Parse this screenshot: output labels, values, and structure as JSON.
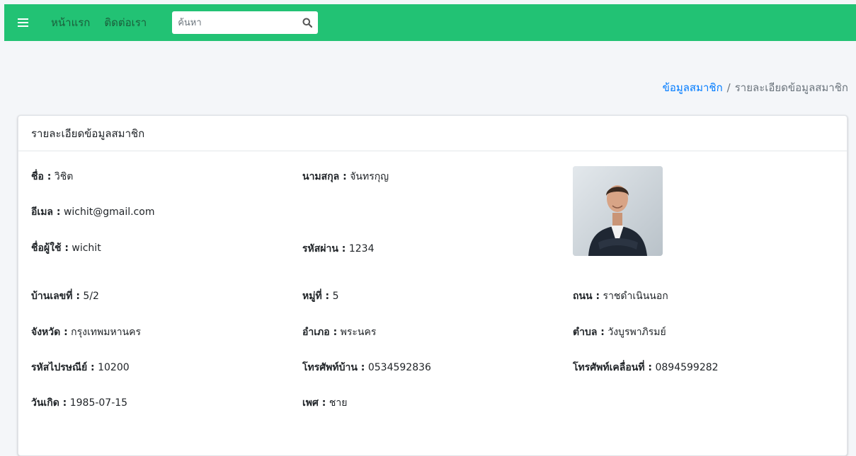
{
  "navbar": {
    "menu_icon": "hamburger-icon",
    "links": [
      "หน้าแรก",
      "ติดต่อเรา"
    ],
    "search": {
      "placeholder": "ค้นหา",
      "value": "",
      "icon": "search-icon"
    },
    "color": "#22c274"
  },
  "breadcrumb": {
    "parent": "ข้อมูลสมาชิก",
    "separator": "/",
    "current": "รายละเอียดข้อมูลสมาชิก"
  },
  "card": {
    "title": "รายละเอียดข้อมูลสมาชิก",
    "photo_alt": "member-photo",
    "fields": {
      "first_name": {
        "label": "ชื่อ :",
        "value": "วิชิต"
      },
      "last_name": {
        "label": "นามสกุล :",
        "value": "จันทรกุญ"
      },
      "email": {
        "label": "อีเมล :",
        "value": "wichit@gmail.com"
      },
      "username": {
        "label": "ชื่อผู้ใช้ :",
        "value": "wichit"
      },
      "password": {
        "label": "รหัสผ่าน :",
        "value": "1234"
      },
      "house_no": {
        "label": "บ้านเลขที่ :",
        "value": "5/2"
      },
      "village_no": {
        "label": "หมู่ที่ :",
        "value": "5"
      },
      "road": {
        "label": "ถนน :",
        "value": "ราชดำเนินนอก"
      },
      "province": {
        "label": "จังหวัด :",
        "value": "กรุงเทพมหานคร"
      },
      "district": {
        "label": "อำเภอ :",
        "value": "พระนคร"
      },
      "subdistrict": {
        "label": "ตำบล :",
        "value": "วังบูรพาภิรมย์"
      },
      "postcode": {
        "label": "รหัสไปรษณีย์ :",
        "value": "10200"
      },
      "home_phone": {
        "label": "โทรศัพท์บ้าน :",
        "value": "0534592836"
      },
      "mobile_phone": {
        "label": "โทรศัพท์เคลื่อนที่ :",
        "value": "0894599282"
      },
      "birthdate": {
        "label": "วันเกิด :",
        "value": "1985-07-15"
      },
      "gender": {
        "label": "เพศ :",
        "value": "ชาย"
      }
    }
  }
}
